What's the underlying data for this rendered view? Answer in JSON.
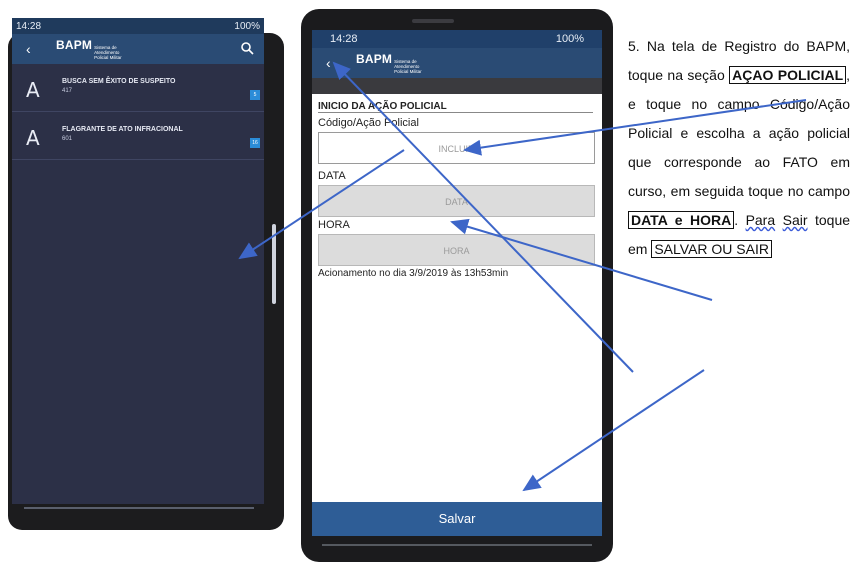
{
  "phone_left": {
    "status": {
      "time": "14:28",
      "battery": "100%"
    },
    "header": {
      "back": "‹",
      "logo_main": "BAPM",
      "logo_sub": "Sistema de Atendimento Policial Militar"
    },
    "items": [
      {
        "letter": "A",
        "title": "BUSCA SEM ÊXITO DE SUSPEITO",
        "code": "417",
        "badge": "5"
      },
      {
        "letter": "A",
        "title": "FLAGRANTE DE ATO INFRACIONAL",
        "code": "601",
        "badge": "16"
      }
    ]
  },
  "phone_center": {
    "status": {
      "time": "14:28",
      "battery": "100%"
    },
    "header": {
      "back": "‹",
      "logo_main": "BAPM",
      "logo_sub": "Sistema de Atendimento Policial Militar"
    },
    "section_title": "INICIO DA AÇÃO POLICIAL",
    "field1_label": "Código/Ação Policial",
    "field1_placeholder": "INCLUIR",
    "field2_label": "DATA",
    "field2_placeholder": "DATA",
    "field3_label": "HORA",
    "field3_placeholder": "HORA",
    "info": "Acionamento no dia 3/9/2019 às 13h53min",
    "save_label": "Salvar"
  },
  "instructions": {
    "p1": "5. Na tela de Registro do BAPM, toque na seção",
    "box1": "AÇAO POLICIAL",
    "p2": ", e toque no campo Código/Ação Policial e escolha a ação policial que corresponde ao FATO em curso, em seguida toque no campo",
    "box2": "DATA e HORA",
    "p3_wavy": "Para",
    "p4_wavy": "Sair",
    "p5": "toque em",
    "box3": "SALVAR OU SAIR"
  }
}
